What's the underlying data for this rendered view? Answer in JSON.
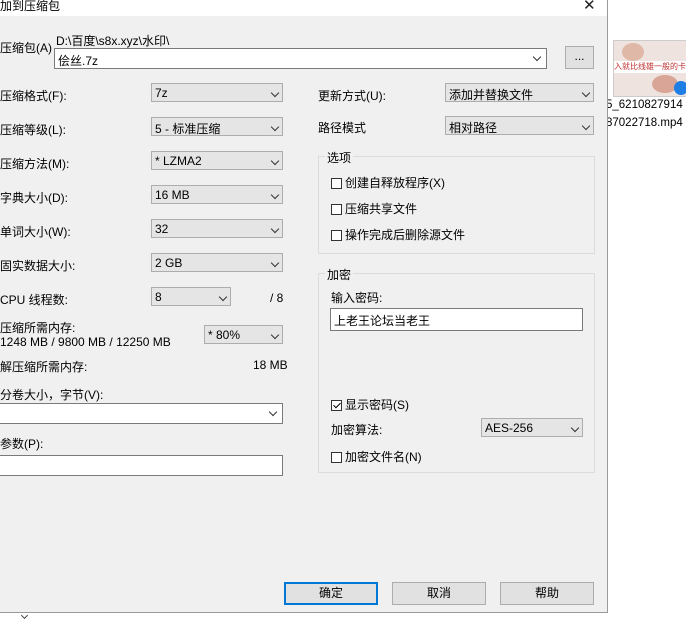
{
  "window": {
    "title": "加到压缩包",
    "close_glyph": "✕"
  },
  "archive": {
    "label": "压缩包(A)",
    "path": "D:\\百度\\s8x.xyz\\水印\\",
    "filename": "侩丝.7z",
    "browse_label": "..."
  },
  "options": [
    {
      "label": "压缩格式(F):",
      "value": "7z"
    },
    {
      "label": "压缩等级(L):",
      "value": "5 - 标准压缩"
    },
    {
      "label": "压缩方法(M):",
      "value": "* LZMA2"
    },
    {
      "label": "字典大小(D):",
      "value": "16 MB"
    },
    {
      "label": "单词大小(W):",
      "value": "32"
    },
    {
      "label": "固实数据大小:",
      "value": "2 GB"
    }
  ],
  "threads": {
    "label": "CPU 线程数:",
    "value": "8",
    "max": "/ 8"
  },
  "memory": {
    "label": "压缩所需内存:",
    "detail": "1248 MB / 9800 MB / 12250 MB",
    "percent": "* 80%",
    "decompress_label": "解压缩所需内存:",
    "decompress_value": "18 MB"
  },
  "volume": {
    "label": "分卷大小，字节(V):",
    "value": ""
  },
  "params": {
    "label": "参数(P):",
    "value": ""
  },
  "update": {
    "label": "更新方式(U):",
    "value": "添加并替换文件"
  },
  "pathmode": {
    "label": "路径模式",
    "value": "相对路径"
  },
  "options_group": {
    "title": "选项",
    "items": [
      {
        "label": "创建自释放程序(X)",
        "checked": false
      },
      {
        "label": "压缩共享文件",
        "checked": false
      },
      {
        "label": "操作完成后删除源文件",
        "checked": false
      }
    ]
  },
  "encryption": {
    "title": "加密",
    "password_label": "输入密码:",
    "password": "上老王论坛当老王",
    "show_password_label": "显示密码(S)",
    "show_password_checked": true,
    "method_label": "加密算法:",
    "method": "AES-256",
    "encrypt_names_label": "加密文件名(N)",
    "encrypt_names_checked": false
  },
  "buttons": {
    "ok": "确定",
    "cancel": "取消",
    "help": "帮助"
  },
  "background_file": {
    "thumb_caption": "入就比线雄一般的卡哥",
    "name_line1": "5_6210827914",
    "name_line2": "87022718.mp4"
  }
}
